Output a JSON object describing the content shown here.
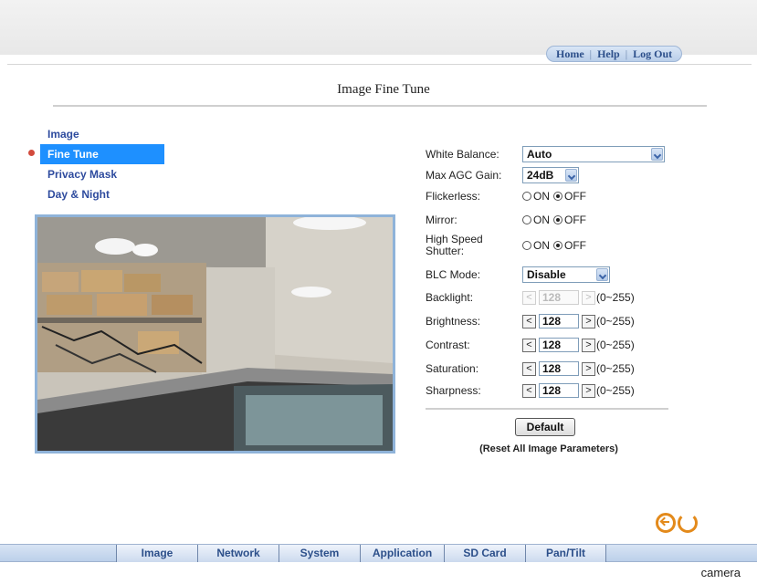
{
  "header": {
    "nav": [
      "Home",
      "Help",
      "Log Out"
    ]
  },
  "page": {
    "title": "Image Fine Tune"
  },
  "sidebar": {
    "items": [
      {
        "label": "Image"
      },
      {
        "label": "Fine Tune",
        "active": true
      },
      {
        "label": "Privacy Mask"
      },
      {
        "label": "Day & Night"
      }
    ]
  },
  "form": {
    "white_balance": {
      "label": "White Balance:",
      "value": "Auto"
    },
    "max_agc_gain": {
      "label": "Max AGC Gain:",
      "value": "24dB"
    },
    "flickerless": {
      "label": "Flickerless:",
      "on": "ON",
      "off": "OFF",
      "selected": "OFF"
    },
    "mirror": {
      "label": "Mirror:",
      "on": "ON",
      "off": "OFF",
      "selected": "OFF"
    },
    "high_speed_shutter": {
      "label_line1": "High Speed",
      "label_line2": "Shutter:",
      "on": "ON",
      "off": "OFF",
      "selected": "OFF"
    },
    "blc_mode": {
      "label": "BLC Mode:",
      "value": "Disable"
    },
    "backlight": {
      "label": "Backlight:",
      "value": "128",
      "range": "(0~255)",
      "disabled": true
    },
    "brightness": {
      "label": "Brightness:",
      "value": "128",
      "range": "(0~255)"
    },
    "contrast": {
      "label": "Contrast:",
      "value": "128",
      "range": "(0~255)"
    },
    "saturation": {
      "label": "Saturation:",
      "value": "128",
      "range": "(0~255)"
    },
    "sharpness": {
      "label": "Sharpness:",
      "value": "128",
      "range": "(0~255)"
    },
    "dec_label": "<",
    "inc_label": ">",
    "default_button": "Default",
    "reset_note": "(Reset All Image Parameters)"
  },
  "bottom_tabs": [
    "Image",
    "Network",
    "System",
    "Application",
    "SD Card",
    "Pan/Tilt"
  ],
  "footer": {
    "label": "camera"
  },
  "colors": {
    "accent": "#1e90ff",
    "nav_text": "#2c4f8a",
    "icon_orange": "#e38a1b",
    "link": "#2e4b9e"
  }
}
